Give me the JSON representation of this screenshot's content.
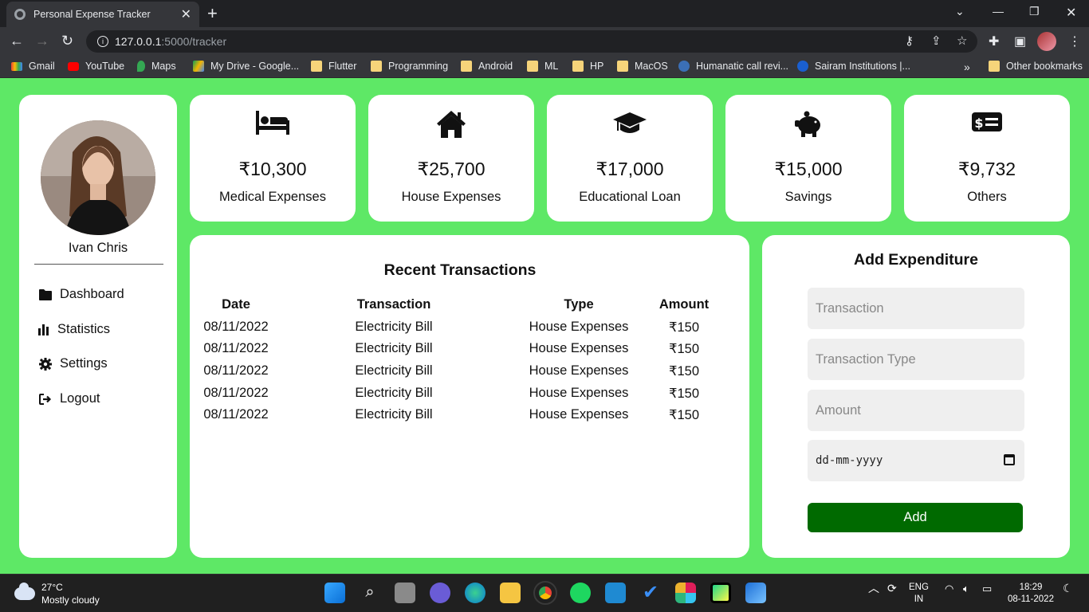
{
  "browser": {
    "tab_title": "Personal Expense Tracker",
    "url_host": "127.0.0.1",
    "url_path": ":5000/tracker",
    "bookmarks": [
      "Gmail",
      "YouTube",
      "Maps",
      "My Drive - Google...",
      "Flutter",
      "Programming",
      "Android",
      "ML",
      "HP",
      "MacOS",
      "Humanatic call revi...",
      "Sairam Institutions |...",
      "Other bookmarks"
    ]
  },
  "sidebar": {
    "username": "Ivan Chris",
    "items": [
      {
        "label": "Dashboard",
        "icon": "folder-icon"
      },
      {
        "label": "Statistics",
        "icon": "bar-chart-icon"
      },
      {
        "label": "Settings",
        "icon": "gear-icon"
      },
      {
        "label": "Logout",
        "icon": "logout-icon"
      }
    ]
  },
  "stats": [
    {
      "amount": "₹10,300",
      "label": "Medical Expenses",
      "icon": "bed-icon"
    },
    {
      "amount": "₹25,700",
      "label": "House Expenses",
      "icon": "house-icon"
    },
    {
      "amount": "₹17,000",
      "label": "Educational Loan",
      "icon": "graduation-cap-icon"
    },
    {
      "amount": "₹15,000",
      "label": "Savings",
      "icon": "piggy-bank-icon"
    },
    {
      "amount": "₹9,732",
      "label": "Others",
      "icon": "money-bill-icon"
    }
  ],
  "recent": {
    "title": "Recent Transactions",
    "headers": [
      "Date",
      "Transaction",
      "Type",
      "Amount"
    ],
    "rows": [
      [
        "08/11/2022",
        "Electricity Bill",
        "House Expenses",
        "₹150"
      ],
      [
        "08/11/2022",
        "Electricity Bill",
        "House Expenses",
        "₹150"
      ],
      [
        "08/11/2022",
        "Electricity Bill",
        "House Expenses",
        "₹150"
      ],
      [
        "08/11/2022",
        "Electricity Bill",
        "House Expenses",
        "₹150"
      ],
      [
        "08/11/2022",
        "Electricity Bill",
        "House Expenses",
        "₹150"
      ]
    ]
  },
  "add": {
    "title": "Add Expenditure",
    "transaction_placeholder": "Transaction",
    "type_placeholder": "Transaction Type",
    "amount_placeholder": "Amount",
    "date_placeholder": "dd-mm-yyyy",
    "button": "Add"
  },
  "taskbar": {
    "temp": "27°C",
    "weather": "Mostly cloudy",
    "lang1": "ENG",
    "lang2": "IN",
    "time": "18:29",
    "date": "08-11-2022"
  },
  "colors": {
    "page_bg": "#5ee866",
    "add_button": "#006a00"
  }
}
